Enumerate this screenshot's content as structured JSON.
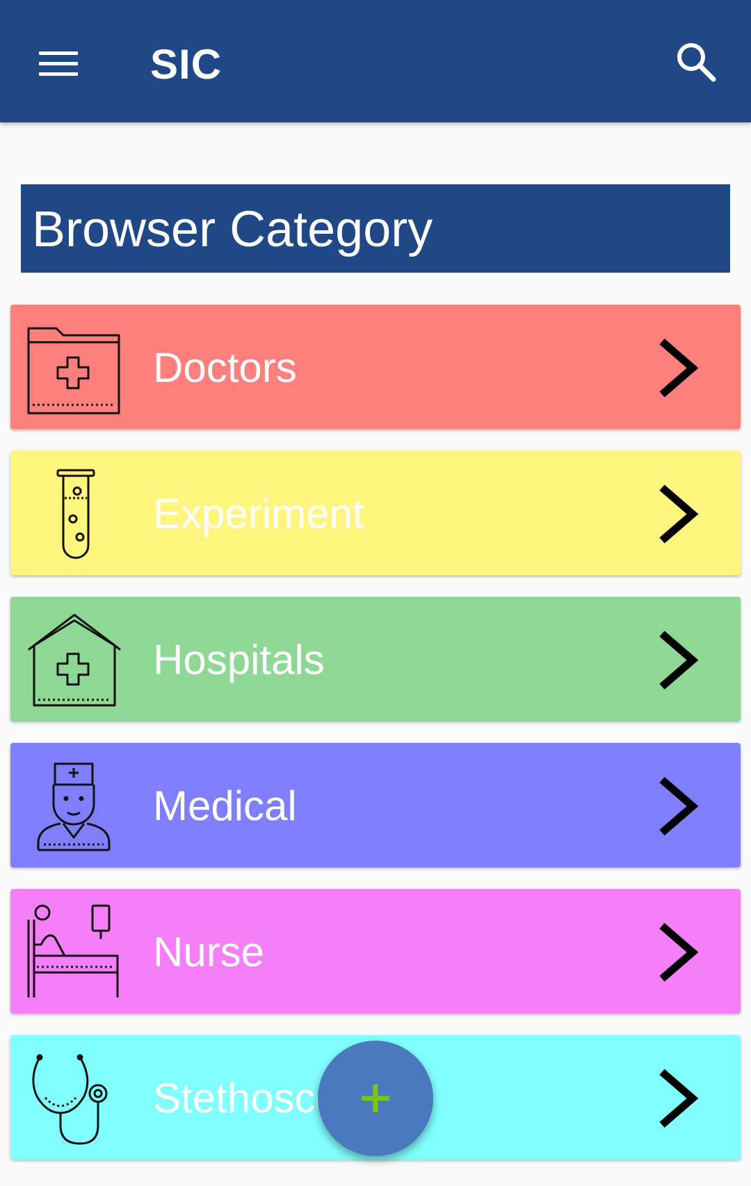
{
  "appbar": {
    "title": "SIC",
    "menu_icon": "menu-icon",
    "search_icon": "search-icon",
    "background": "#214886"
  },
  "section": {
    "title": "Browser Category"
  },
  "categories": [
    {
      "label": "Doctors",
      "icon": "medical-folder-icon",
      "color": "#ff7f7c"
    },
    {
      "label": "Experiment",
      "icon": "test-tube-icon",
      "color": "#fff57f"
    },
    {
      "label": "Hospitals",
      "icon": "hospital-icon",
      "color": "#8fd794"
    },
    {
      "label": "Medical",
      "icon": "doctor-icon",
      "color": "#7f7ffe"
    },
    {
      "label": "Nurse",
      "icon": "hospital-bed-icon",
      "color": "#f57ff9"
    },
    {
      "label": "Stethoscope",
      "icon": "stethoscope-icon",
      "color": "#80fffe"
    }
  ],
  "fab": {
    "icon": "plus-icon",
    "background": "#4a79c0",
    "icon_color": "#7cc60f"
  }
}
